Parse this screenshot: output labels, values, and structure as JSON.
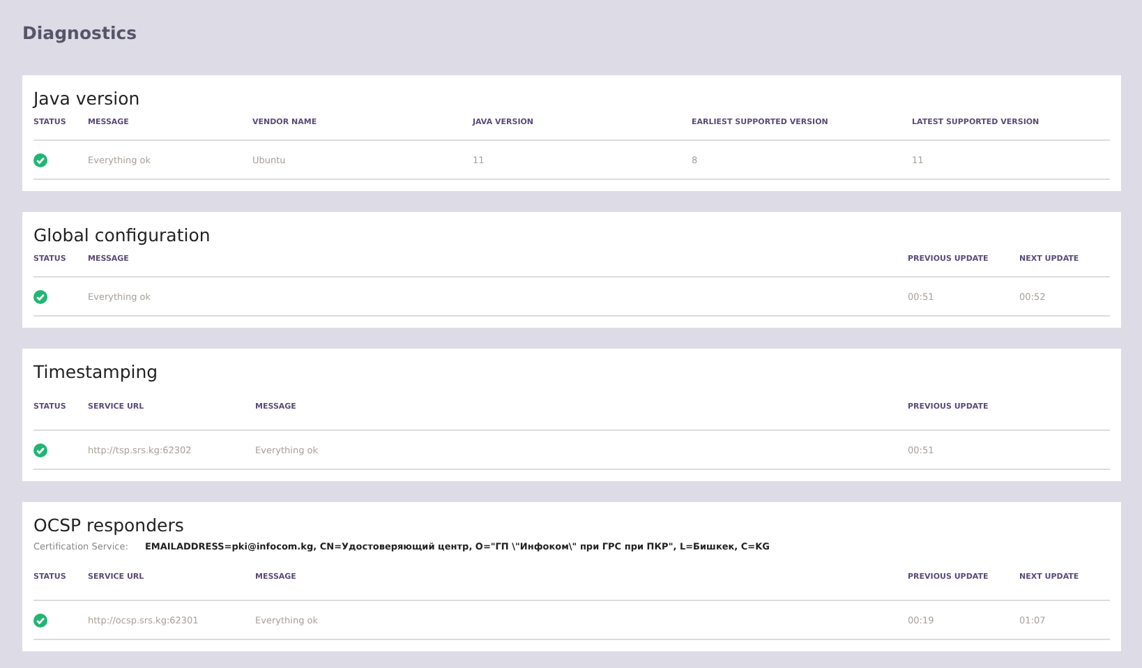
{
  "page_title": "Diagnostics",
  "cards": [
    {
      "title": "Java version",
      "status_column": "STATUS",
      "columns": [
        "MESSAGE",
        "VENDOR NAME",
        "JAVA VERSION",
        "EARLIEST SUPPORTED VERSION",
        "LATEST SUPPORTED VERSION"
      ],
      "rows": [
        {
          "ok": true,
          "cells": [
            "Everything ok",
            "Ubuntu",
            "11",
            "8",
            "11"
          ]
        }
      ]
    },
    {
      "title": "Global configuration",
      "status_column": "STATUS",
      "columns": [
        "MESSAGE",
        "PREVIOUS UPDATE",
        "NEXT UPDATE"
      ],
      "rows": [
        {
          "ok": true,
          "cells": [
            "Everything ok",
            "00:51",
            "00:52"
          ]
        }
      ]
    },
    {
      "title": "Timestamping",
      "status_column": "STATUS",
      "columns": [
        "SERVICE URL",
        "MESSAGE",
        "PREVIOUS UPDATE"
      ],
      "rows": [
        {
          "ok": true,
          "cells": [
            "http://tsp.srs.kg:62302",
            "Everything ok",
            "00:51"
          ]
        }
      ]
    },
    {
      "title": "OCSP responders",
      "certification": {
        "label": "Certification Service:",
        "value": "EMAILADDRESS=pki@infocom.kg, CN=Удостоверяющий центр, O=\"ГП \\\"Инфоком\\\" при ГРС при ПКР\", L=Бишкек, C=KG"
      },
      "status_column": "STATUS",
      "columns": [
        "SERVICE URL",
        "MESSAGE",
        "PREVIOUS UPDATE",
        "NEXT UPDATE"
      ],
      "rows": [
        {
          "ok": true,
          "cells": [
            "http://ocsp.srs.kg:62301",
            "Everything ok",
            "00:19",
            "01:07"
          ]
        }
      ]
    }
  ]
}
